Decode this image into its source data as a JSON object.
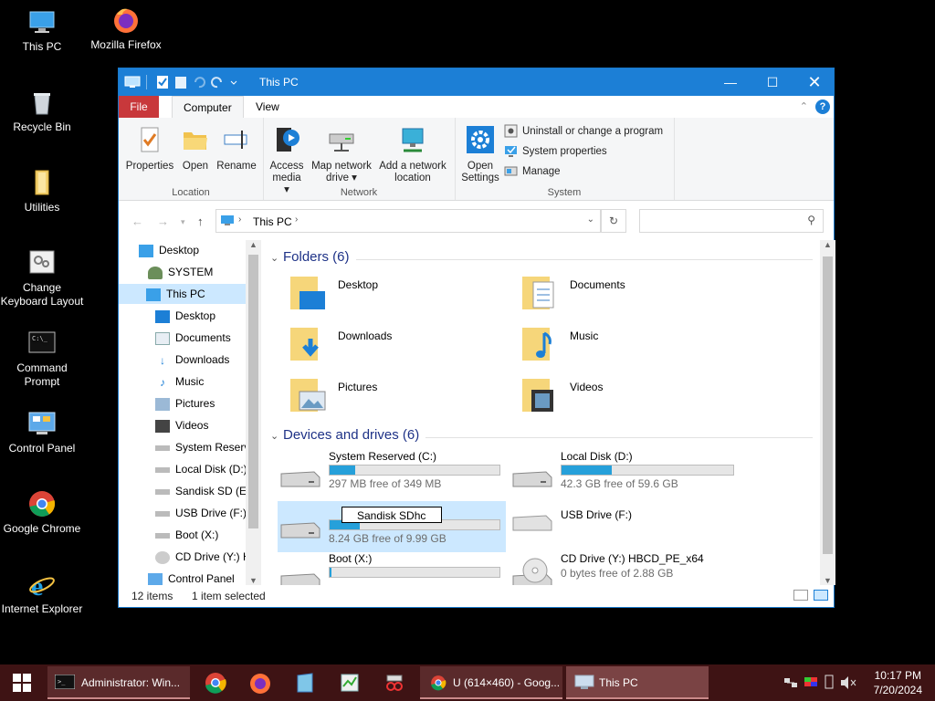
{
  "desktop": {
    "icons": [
      {
        "label": "This PC"
      },
      {
        "label": "Mozilla Firefox"
      },
      {
        "label": "Recycle Bin"
      },
      {
        "label": "Utilities"
      },
      {
        "label": "Change Keyboard Layout"
      },
      {
        "label": "Command Prompt"
      },
      {
        "label": "Control Panel"
      },
      {
        "label": "Google Chrome"
      },
      {
        "label": "Internet Explorer"
      }
    ]
  },
  "window": {
    "title": "This PC",
    "tabs": {
      "file": "File",
      "computer": "Computer",
      "view": "View"
    },
    "ribbon": {
      "location": {
        "label": "Location",
        "properties": "Properties",
        "open": "Open",
        "rename": "Rename"
      },
      "network": {
        "label": "Network",
        "access_media": "Access media",
        "map_drive": "Map network drive",
        "add_location": "Add a network location"
      },
      "system": {
        "label": "System",
        "open_settings": "Open Settings",
        "uninstall": "Uninstall or change a program",
        "system_properties": "System properties",
        "manage": "Manage"
      }
    },
    "address": {
      "path": "This PC",
      "search_placeholder": ""
    },
    "nav_pane": [
      {
        "label": "Desktop",
        "level": 0
      },
      {
        "label": "SYSTEM",
        "level": 1
      },
      {
        "label": "This PC",
        "level": 1,
        "selected": true
      },
      {
        "label": "Desktop",
        "level": 2
      },
      {
        "label": "Documents",
        "level": 2
      },
      {
        "label": "Downloads",
        "level": 2
      },
      {
        "label": "Music",
        "level": 2
      },
      {
        "label": "Pictures",
        "level": 2
      },
      {
        "label": "Videos",
        "level": 2
      },
      {
        "label": "System Reserve",
        "level": 2
      },
      {
        "label": "Local Disk (D:)",
        "level": 2
      },
      {
        "label": "Sandisk SD (E:)",
        "level": 2
      },
      {
        "label": "USB Drive (F:)",
        "level": 2
      },
      {
        "label": "Boot (X:)",
        "level": 2
      },
      {
        "label": "CD Drive (Y:) H",
        "level": 2
      },
      {
        "label": "Control Panel",
        "level": 1
      }
    ],
    "folders": {
      "heading": "Folders (6)",
      "items": [
        "Desktop",
        "Documents",
        "Downloads",
        "Music",
        "Pictures",
        "Videos"
      ]
    },
    "drives": {
      "heading": "Devices and drives (6)",
      "items": [
        {
          "name": "System Reserved (C:)",
          "free": "297 MB free of 349 MB",
          "used_fraction": 0.15
        },
        {
          "name": "Local Disk (D:)",
          "free": "42.3 GB free of 59.6 GB",
          "used_fraction": 0.29
        },
        {
          "name": "Sandisk SDhc",
          "free": "8.24 GB free of 9.99 GB",
          "used_fraction": 0.18,
          "renaming": true
        },
        {
          "name": "USB Drive (F:)",
          "free": "",
          "used_fraction": null
        },
        {
          "name": "Boot (X:)",
          "free": "",
          "used_fraction": 0.01
        },
        {
          "name": "CD Drive (Y:) HBCD_PE_x64",
          "free": "0 bytes free of 2.88 GB",
          "used_fraction": null
        }
      ]
    },
    "status": {
      "items": "12 items",
      "selected": "1 item selected"
    }
  },
  "taskbar": {
    "apps": [
      {
        "label": "Administrator: Win..."
      },
      {
        "label": "U (614×460) - Goog..."
      },
      {
        "label": "This PC"
      }
    ],
    "clock": {
      "time": "10:17 PM",
      "date": "7/20/2024"
    }
  },
  "colors": {
    "accent": "#1c7fd6",
    "taskbar": "#3e1314",
    "selection": "#cce8ff",
    "drive_bar": "#26a0da"
  }
}
